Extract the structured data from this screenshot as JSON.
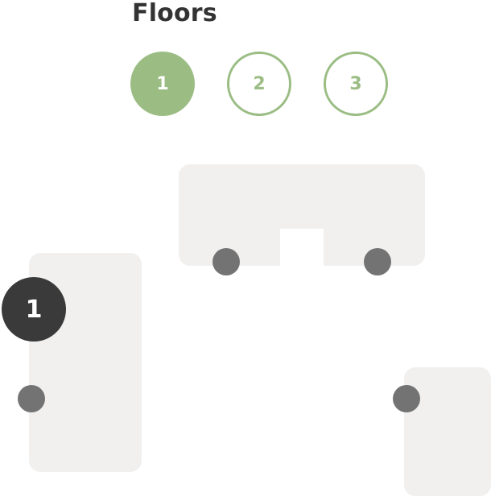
{
  "header": {
    "title": "Floors"
  },
  "floors": [
    {
      "label": "1",
      "state": "active"
    },
    {
      "label": "2",
      "state": "inactive"
    },
    {
      "label": "3",
      "state": "inactive"
    }
  ],
  "selected_marker": {
    "label": "1"
  },
  "colors": {
    "accent": "#9bbd84",
    "room_fill": "#f1f0ef",
    "hotspot": "#737373",
    "marker": "#3a3a3a",
    "title_text": "#333333"
  }
}
